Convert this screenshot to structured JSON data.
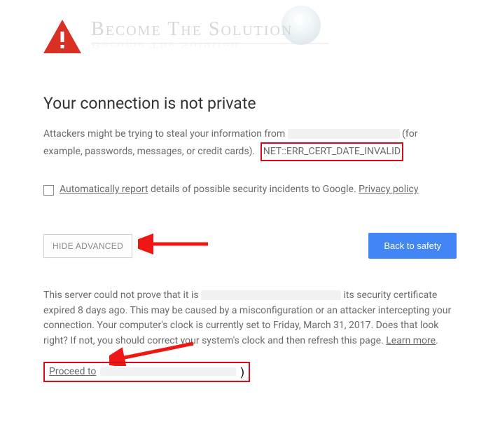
{
  "heading": "Your connection is not private",
  "desc_pre": "Attackers might be trying to steal your information from ",
  "desc_post": " (for example, passwords, messages, or credit cards). ",
  "error_code": "NET::ERR_CERT_DATE_INVALID",
  "report_link": "Automatically report",
  "report_tail": " details of possible security incidents to Google. ",
  "privacy_link": "Privacy policy",
  "hide_btn": "HIDE ADVANCED",
  "back_btn": "Back to safety",
  "details_pre": "This server could not prove that it is ",
  "details_mid": " its security certificate expired 8 days ago. This may be caused by a misconfiguration or an attacker intercepting your connection. Your computer's clock is currently set to Friday, March 31, 2017. Does that look right? If not, you should correct your system's clock and then refresh this page. ",
  "learn_more": "Learn more",
  "proceed_label": "Proceed to",
  "proceed_tail": ")",
  "watermark_text": "Become The Solution"
}
